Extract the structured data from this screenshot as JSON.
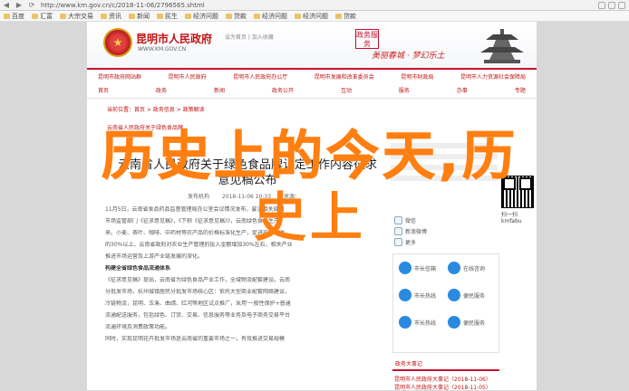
{
  "browser": {
    "url": "http://www.km.gov.cn/c/2018-11-06/2796565.shtml",
    "bookmarks": [
      "百度",
      "汇富",
      "大宗交易",
      "资讯",
      "新闻",
      "民生",
      "经济问题",
      "贷款",
      "经济问题",
      "经济问题",
      "贷款"
    ]
  },
  "header": {
    "site_name": "昆明市人民政府",
    "site_url": "WWW.KM.GOV.CN",
    "links": "设为首页 | 加入收藏",
    "service_button": "政务服务",
    "slogan": "美丽春城 · 梦幻乐土"
  },
  "nav_primary": [
    "昆明市政府网站群",
    "昆明市人民政府",
    "昆明市人民政府办公厅",
    "昆明市发展和改革委员会",
    "昆明市财政局",
    "昆明市人力资源社会保障局"
  ],
  "nav_secondary": [
    "首页",
    "政务",
    "新闻",
    "政务公开",
    "互动",
    "服务",
    "办事",
    "专题"
  ],
  "breadcrumb": "当前位置：首页 > 政务信息 > 政策解读",
  "breadcrumb2": "云南省人民政府关于绿色食品牌",
  "article": {
    "title": "云南省人民政府关于绿色食品牌认定工作内容征求意见稿公布",
    "source": "发布机构",
    "date": "2018-11-06 10:33",
    "from": "来源："
  },
  "body_lines": [
    "11月5日，云南省食品药品监督管理局办公室会议情况发布，要求相关部门",
    "市场监管部门《征求意见稿》，《下称《征求意见稿》》，云南绿色食品生产",
    "来。小麦、茶叶、咖啡、中药材等农产品的价格标准化生产，促进农业增收",
    "的30%以上，云南省政府对农业生产管理的投入金额增加30%左右，相关产业",
    "推进市场运营及上游产业链发展的深化。",
    "构建全省绿色食品流通体系",
    "《征求意见稿》提出，云南省为绿色食品产业工作，全域物流配套建设。云南",
    "分批发市场，杭州城镇居民分批发市场核心区：依托大型商业配套网络建设，",
    "冷链物流，昆明、玉溪、曲靖、红河等地区试点推广，采用'一般性保护+普通",
    "流通配送服务，包括绿色、订货、交易、信息服务等业务及电子商务交易平台",
    "流通环境及消费政策功能。",
    "同时，实现昆明花卉批发市场是云南省的重要市场之一，有效推进交易规模"
  ],
  "sidebar": {
    "qr_caption": "扫一扫 kmfabu",
    "share": [
      "微信",
      "新浪微博",
      "更多"
    ],
    "apps": [
      {
        "title": "市长信箱",
        "sub": "在线咨询"
      },
      {
        "title": "市长热线",
        "sub": "便民服务"
      },
      {
        "title": "市长热线",
        "sub": "便民服务"
      }
    ],
    "events_title": "政务大事记",
    "events": [
      "昆明市人民政府大事记（2018-11-06）",
      "昆明市人民政府大事记（2018-11-05）",
      "昆明市人民政府大事记（2018-11-02）",
      "昆明市人民政府大事记（2018-11-01）"
    ]
  },
  "overlay": {
    "line1": "历史上的今天,历",
    "line2": "史上"
  }
}
